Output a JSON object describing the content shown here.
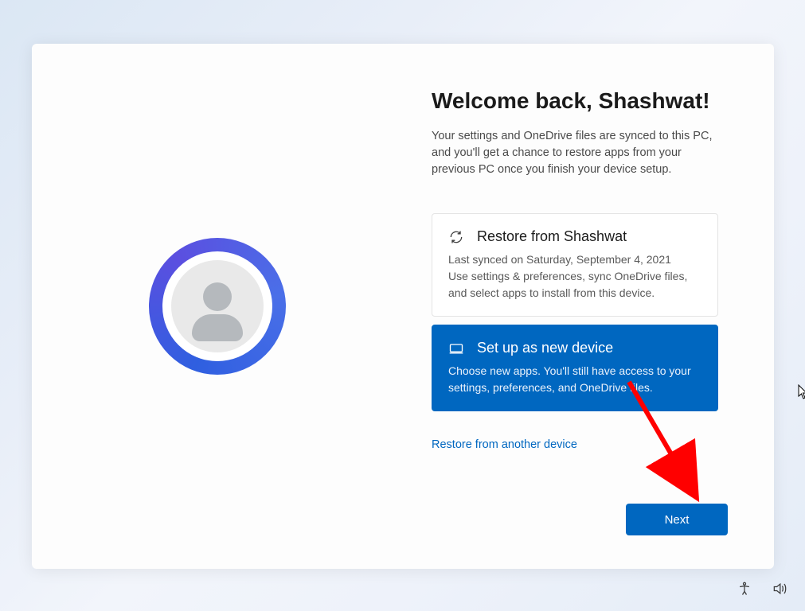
{
  "title": "Welcome back, Shashwat!",
  "subtitle": "Your settings and OneDrive files are synced to this PC, and you'll get a chance to restore apps from your previous PC once you finish your device setup.",
  "option_restore": {
    "title": "Restore from Shashwat",
    "desc": "Last synced on Saturday, September 4, 2021\nUse settings & preferences, sync OneDrive files, and select apps to install from this device."
  },
  "option_new": {
    "title": "Set up as new device",
    "desc": "Choose new apps. You'll still have access to your settings, preferences, and OneDrive files."
  },
  "restore_link": "Restore from another device",
  "next_label": "Next",
  "icons": {
    "restore": "refresh-icon",
    "new": "device-icon",
    "accessibility": "accessibility-icon",
    "volume": "volume-icon"
  }
}
